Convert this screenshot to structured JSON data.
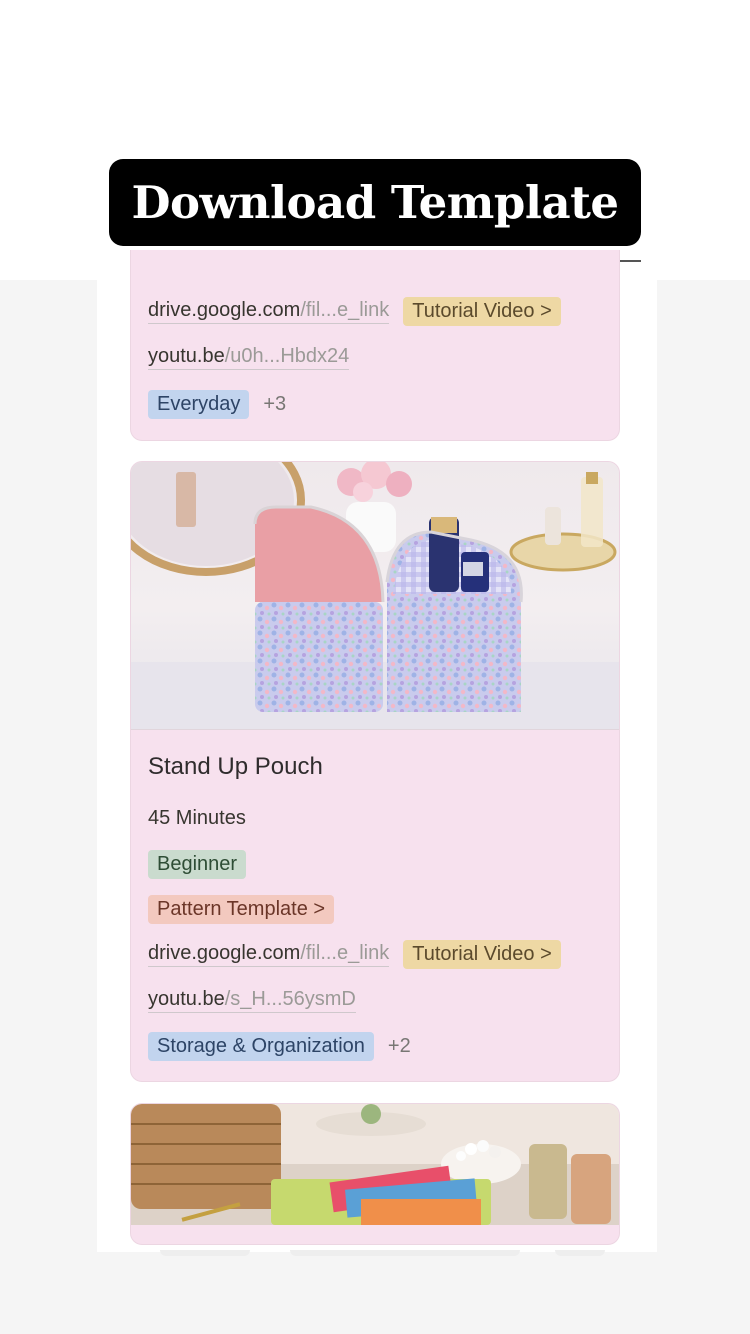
{
  "banner": {
    "title": "Download Template"
  },
  "cards": [
    {
      "drive_link": {
        "domain": "drive.google.com",
        "path": "/fil...e_link"
      },
      "tutorial_label": "Tutorial Video >",
      "youtube_link": {
        "domain": "youtu.be",
        "path": "/u0h...Hbdx24"
      },
      "category_tag": "Everyday",
      "more_count": "+3"
    },
    {
      "title": "Stand Up Pouch",
      "duration": "45 Minutes",
      "level": "Beginner",
      "pattern_label": "Pattern Template >",
      "drive_link": {
        "domain": "drive.google.com",
        "path": "/fil...e_link"
      },
      "tutorial_label": "Tutorial Video >",
      "youtube_link": {
        "domain": "youtu.be",
        "path": "/s_H...56ysmD"
      },
      "category_tag": "Storage & Organization",
      "more_count": "+2"
    }
  ],
  "colors": {
    "card_background": "#f7e1ee",
    "tag_yellow": "#eed8a4",
    "tag_blue": "#c2d4ee",
    "tag_green": "#cadbce",
    "tag_pink": "#f3c9bf"
  }
}
